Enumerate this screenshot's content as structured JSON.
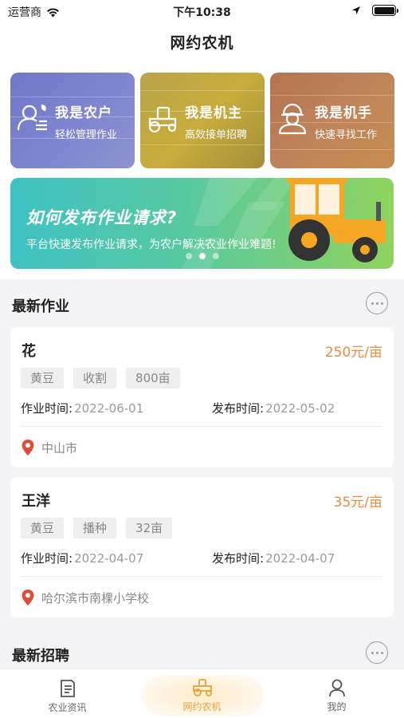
{
  "status_bar": {
    "carrier": "运营商",
    "time": "下午10:38",
    "battery_level": 1.0
  },
  "nav": {
    "title": "网约农机"
  },
  "roles": [
    {
      "title": "我是农户",
      "subtitle": "轻松管理作业",
      "icon": "farmer-icon"
    },
    {
      "title": "我是机主",
      "subtitle": "高效接单招聘",
      "icon": "tractor-icon"
    },
    {
      "title": "我是机手",
      "subtitle": "快速寻找工作",
      "icon": "worker-icon"
    }
  ],
  "banner": {
    "title": "如何发布作业请求?",
    "desc": "平台快速发布作业请求，为农户解决农业作业难题!",
    "slide_count": 3,
    "active_slide": 1
  },
  "latest_jobs": {
    "title": "最新作业",
    "items": [
      {
        "name": "花",
        "price": "250元/亩",
        "tags": [
          "黄豆",
          "收割",
          "800亩"
        ],
        "work_time_label": "作业时间:",
        "work_time": "2022-06-01",
        "publish_time_label": "发布时间:",
        "publish_time": "2022-05-02",
        "location": "中山市"
      },
      {
        "name": "王洋",
        "price": "35元/亩",
        "tags": [
          "黄豆",
          "播种",
          "32亩"
        ],
        "work_time_label": "作业时间:",
        "work_time": "2022-04-07",
        "publish_time_label": "发布时间:",
        "publish_time": "2022-04-07",
        "location": "哈尔滨市南棵小学校"
      }
    ]
  },
  "latest_recruit": {
    "title": "最新招聘"
  },
  "tabs": [
    {
      "label": "农业资讯",
      "icon": "news-icon"
    },
    {
      "label": "网约农机",
      "icon": "tractor-icon"
    },
    {
      "label": "我的",
      "icon": "profile-icon"
    }
  ],
  "colors": {
    "accent": "#f08a3a",
    "tab_active": "#e8a33a"
  }
}
